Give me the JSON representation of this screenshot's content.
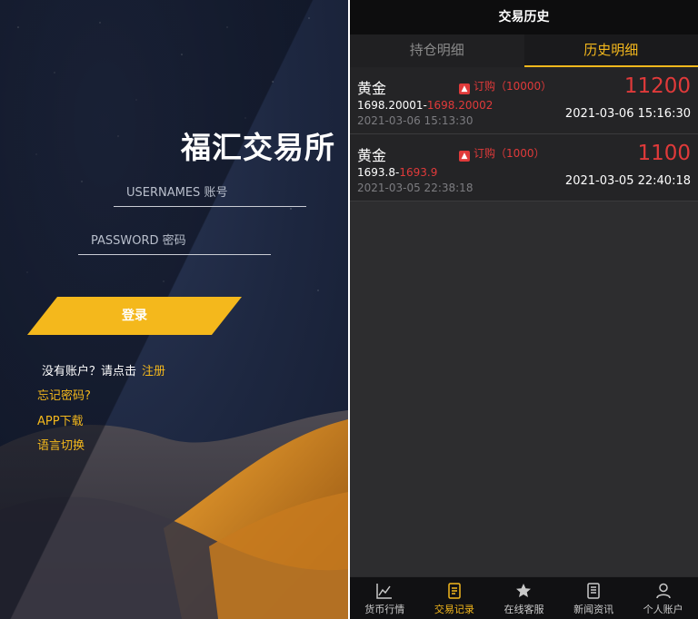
{
  "login": {
    "brand": "福汇交易所",
    "username_placeholder": "USERNAMES 账号",
    "password_placeholder": "PASSWORD 密码",
    "login_button": "登录",
    "no_account_text": "没有账户？请点击",
    "register_link": "注册",
    "forgot_password": "忘记密码?",
    "app_download": "APP下载",
    "language_switch": "语言切换"
  },
  "history": {
    "title": "交易历史",
    "tabs": [
      {
        "label": "持仓明细",
        "active": false
      },
      {
        "label": "历史明细",
        "active": true
      }
    ],
    "records": [
      {
        "name": "黄金",
        "badge": "订购（10000）",
        "open_price": "1698.20001",
        "close_price": "1698.20002",
        "open_time": "2021-03-06 15:13:30",
        "amount": "11200",
        "close_time": "2021-03-06 15:16:30"
      },
      {
        "name": "黄金",
        "badge": "订购（1000）",
        "open_price": "1693.8",
        "close_price": "1693.9",
        "open_time": "2021-03-05 22:38:18",
        "amount": "1100",
        "close_time": "2021-03-05 22:40:18"
      }
    ],
    "nav": [
      {
        "label": "货币行情",
        "icon": "chart-icon",
        "active": false
      },
      {
        "label": "交易记录",
        "icon": "record-icon",
        "active": true
      },
      {
        "label": "在线客服",
        "icon": "star-icon",
        "active": false
      },
      {
        "label": "新闻资讯",
        "icon": "news-icon",
        "active": false
      },
      {
        "label": "个人账户",
        "icon": "user-icon",
        "active": false
      }
    ]
  },
  "colors": {
    "accent": "#f4b81c",
    "loss_red": "#e03a3a",
    "panel_bg": "#2d2d2f"
  }
}
